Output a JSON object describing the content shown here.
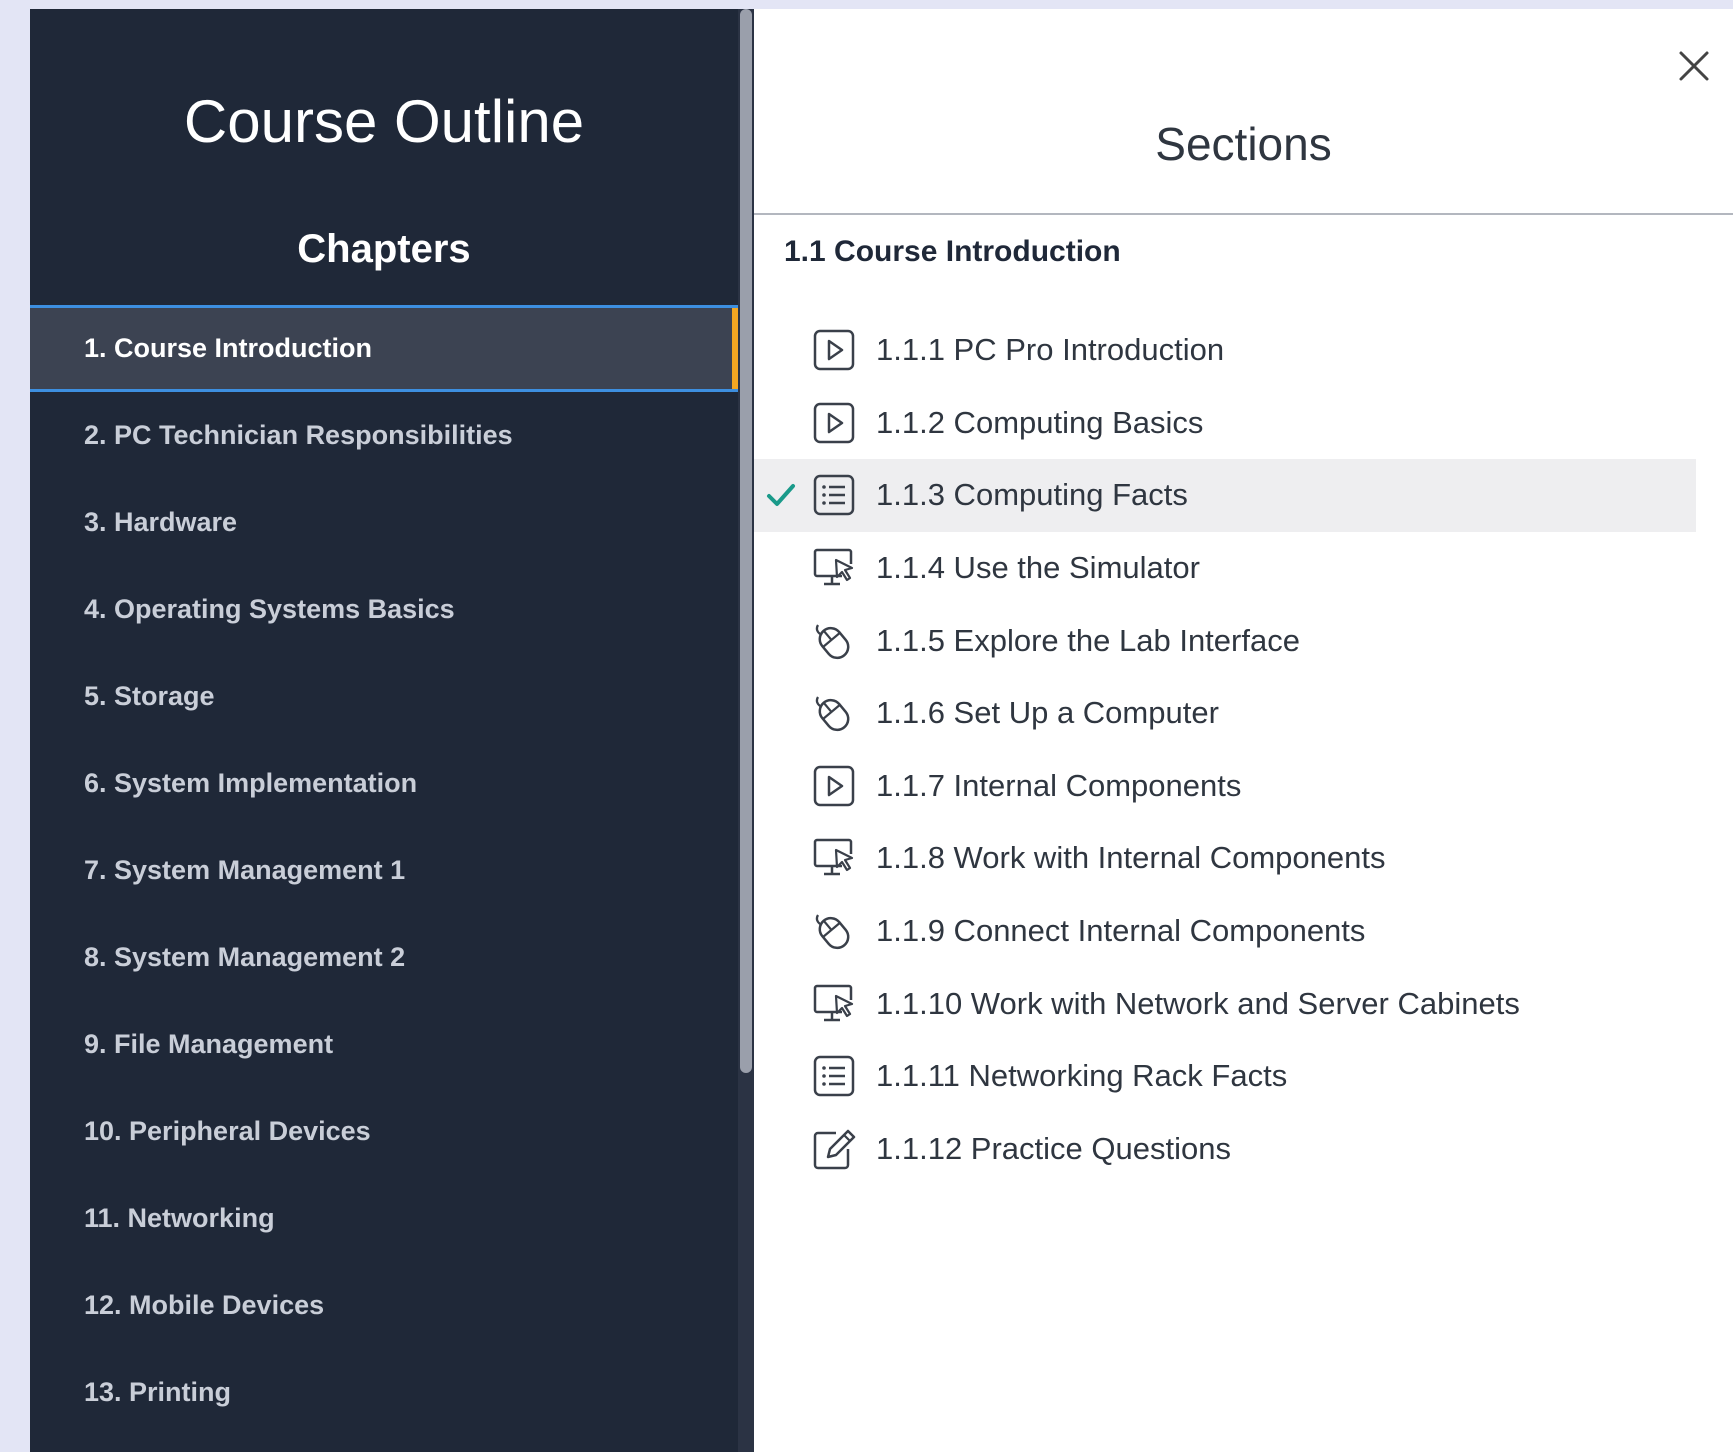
{
  "outline": {
    "title": "Course Outline",
    "subtitle": "Chapters",
    "chapters": [
      {
        "label": "1. Course Introduction",
        "active": true
      },
      {
        "label": "2. PC Technician Responsibilities"
      },
      {
        "label": "3. Hardware"
      },
      {
        "label": "4. Operating Systems Basics"
      },
      {
        "label": "5. Storage"
      },
      {
        "label": "6. System Implementation"
      },
      {
        "label": "7. System Management 1"
      },
      {
        "label": "8. System Management 2"
      },
      {
        "label": "9. File Management"
      },
      {
        "label": "10. Peripheral Devices"
      },
      {
        "label": "11. Networking"
      },
      {
        "label": "12. Mobile Devices"
      },
      {
        "label": "13. Printing"
      }
    ]
  },
  "sections_panel": {
    "title": "Sections",
    "heading": "1.1 Course Introduction",
    "items": [
      {
        "label": "1.1.1 PC Pro Introduction",
        "icon": "video-play-icon"
      },
      {
        "label": "1.1.2 Computing Basics",
        "icon": "video-play-icon"
      },
      {
        "label": "1.1.3 Computing Facts",
        "icon": "list-icon",
        "completed": true
      },
      {
        "label": "1.1.4 Use the Simulator",
        "icon": "monitor-pointer-icon"
      },
      {
        "label": "1.1.5 Explore the Lab Interface",
        "icon": "mouse-icon"
      },
      {
        "label": "1.1.6 Set Up a Computer",
        "icon": "mouse-icon"
      },
      {
        "label": "1.1.7 Internal Components",
        "icon": "video-play-icon"
      },
      {
        "label": "1.1.8 Work with Internal Components",
        "icon": "monitor-pointer-icon"
      },
      {
        "label": "1.1.9 Connect Internal Components",
        "icon": "mouse-icon"
      },
      {
        "label": "1.1.10 Work with Network and Server Cabinets",
        "icon": "monitor-pointer-icon"
      },
      {
        "label": "1.1.11 Networking Rack Facts",
        "icon": "list-icon"
      },
      {
        "label": "1.1.12 Practice Questions",
        "icon": "edit-pencil-icon"
      }
    ]
  },
  "colors": {
    "panel_bg": "#1f2838",
    "active_bg": "#3c4352",
    "active_border": "#3d8fe0",
    "active_marker": "#f4a722",
    "check": "#1a9a8a"
  }
}
